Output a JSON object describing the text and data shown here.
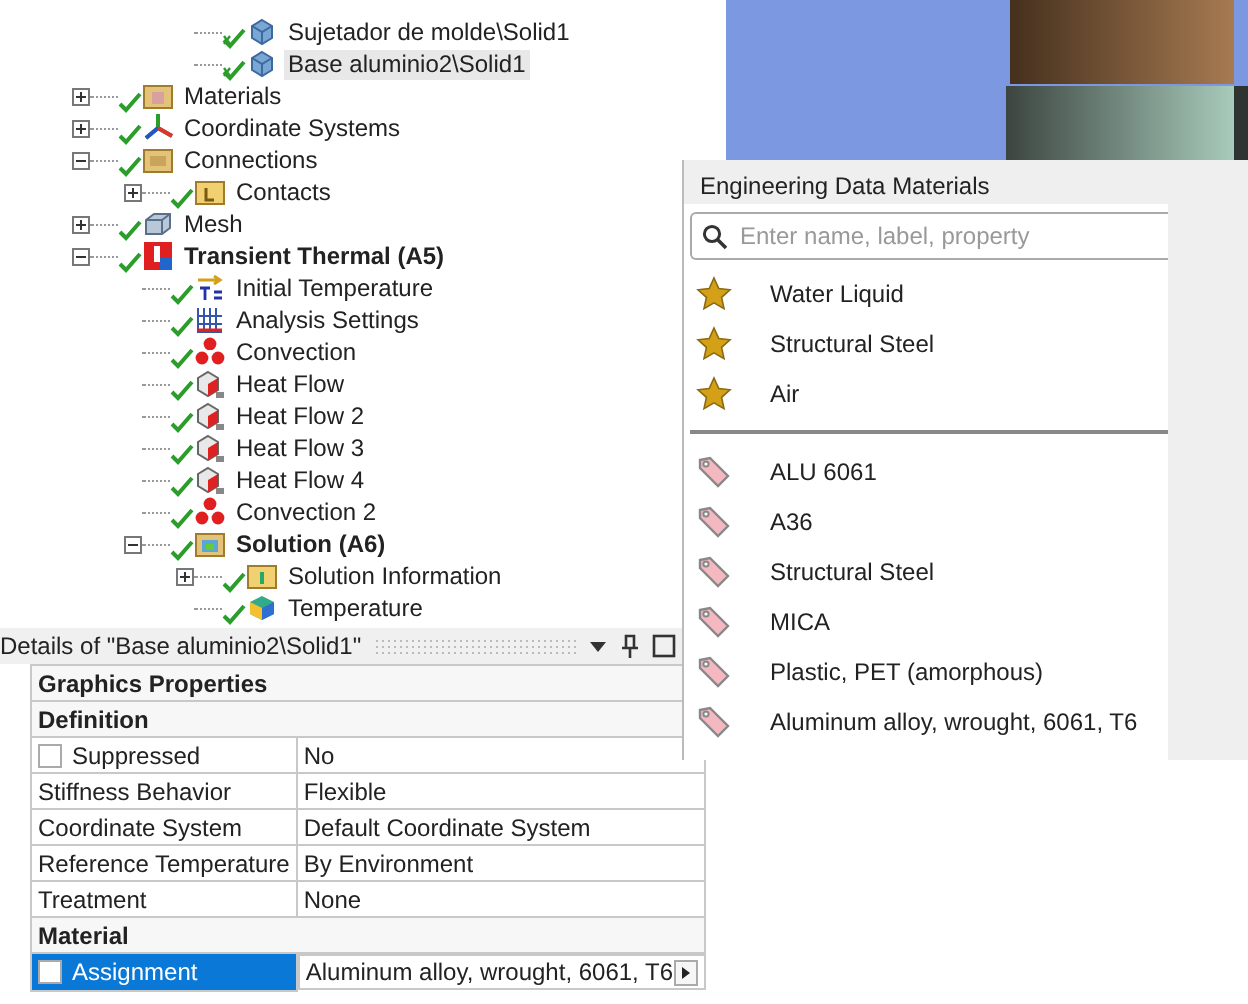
{
  "tree": {
    "cut_off_parent_children": [
      {
        "label": "Sujetador de molde\\Solid1",
        "kind": "part",
        "ok": true,
        "selected": false
      },
      {
        "label": "Base aluminio2\\Solid1",
        "kind": "part",
        "ok": true,
        "selected": true
      }
    ],
    "items": [
      {
        "label": "Materials",
        "kind": "materials",
        "ok": true,
        "expanded": false,
        "selected": false
      },
      {
        "label": "Coordinate Systems",
        "kind": "coords",
        "ok": true,
        "expanded": false,
        "selected": false
      },
      {
        "label": "Connections",
        "kind": "folder",
        "ok": true,
        "expanded": true,
        "selected": false,
        "children": [
          {
            "label": "Contacts",
            "kind": "contacts",
            "ok": true,
            "expanded": false,
            "selected": false
          }
        ]
      },
      {
        "label": "Mesh",
        "kind": "mesh",
        "ok": true,
        "expanded": false,
        "selected": false
      },
      {
        "label": "Transient Thermal (A5)",
        "kind": "analysis",
        "ok": true,
        "expanded": true,
        "bold": true,
        "selected": false,
        "children": [
          {
            "label": "Initial Temperature",
            "kind": "init-temp",
            "ok": true,
            "selected": false
          },
          {
            "label": "Analysis Settings",
            "kind": "settings",
            "ok": true,
            "selected": false
          },
          {
            "label": "Convection",
            "kind": "convection",
            "ok": true,
            "selected": false
          },
          {
            "label": "Heat Flow",
            "kind": "heat-flow",
            "ok": true,
            "selected": false
          },
          {
            "label": "Heat Flow 2",
            "kind": "heat-flow",
            "ok": true,
            "selected": false
          },
          {
            "label": "Heat Flow 3",
            "kind": "heat-flow",
            "ok": true,
            "selected": false
          },
          {
            "label": "Heat Flow 4",
            "kind": "heat-flow",
            "ok": true,
            "selected": false
          },
          {
            "label": "Convection 2",
            "kind": "convection",
            "ok": true,
            "selected": false
          },
          {
            "label": "Solution (A6)",
            "kind": "solution",
            "ok": true,
            "expanded": true,
            "bold": true,
            "selected": false,
            "children": [
              {
                "label": "Solution Information",
                "kind": "sol-info",
                "ok": true,
                "expanded": false,
                "selected": false
              },
              {
                "label": "Temperature",
                "kind": "temperature",
                "ok": true,
                "selected": false
              }
            ]
          }
        ]
      }
    ]
  },
  "details": {
    "title": "Details of \"Base aluminio2\\Solid1\"",
    "rows": [
      {
        "kind": "group",
        "label": "Graphics Properties"
      },
      {
        "kind": "group",
        "label": "Definition"
      },
      {
        "kind": "property",
        "label": "Suppressed",
        "value": "No",
        "checked": false,
        "selected": false
      },
      {
        "kind": "property",
        "label": "Stiffness Behavior",
        "value": "Flexible",
        "selected": false
      },
      {
        "kind": "property",
        "label": "Coordinate System",
        "value": "Default Coordinate System",
        "selected": false
      },
      {
        "kind": "property",
        "label": "Reference Temperature",
        "value": "By Environment",
        "selected": false
      },
      {
        "kind": "property",
        "label": "Treatment",
        "value": "None",
        "selected": false
      },
      {
        "kind": "group",
        "label": "Material"
      },
      {
        "kind": "property",
        "label": "Assignment",
        "value": "Aluminum alloy, wrought, 6061, T6",
        "checked": false,
        "selected": true,
        "dropdown": true
      }
    ]
  },
  "materials_popup": {
    "title": "Engineering Data Materials",
    "search": {
      "placeholder": "Enter name, label, property"
    },
    "items": [
      {
        "kind": "favorite",
        "label": "Water Liquid"
      },
      {
        "kind": "favorite",
        "label": "Structural Steel"
      },
      {
        "kind": "favorite",
        "label": "Air"
      },
      {
        "kind": "library",
        "label": "ALU 6061"
      },
      {
        "kind": "library",
        "label": "A36"
      },
      {
        "kind": "library",
        "label": "Structural Steel"
      },
      {
        "kind": "library",
        "label": "MICA"
      },
      {
        "kind": "library",
        "label": "Plastic, PET (amorphous)"
      },
      {
        "kind": "library",
        "label": "Aluminum alloy, wrought, 6061, T6"
      }
    ]
  }
}
